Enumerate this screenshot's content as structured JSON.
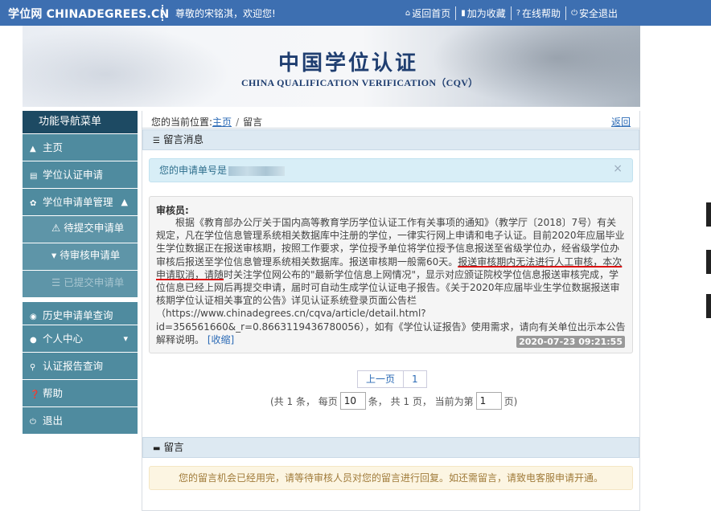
{
  "header": {
    "brand": "学位网 CHINADEGREES.CN",
    "welcome": "尊敬的宋铭淇，欢迎您!",
    "links": [
      {
        "icon": "home-icon",
        "glyph": "⌂",
        "label": "返回首页"
      },
      {
        "icon": "bookmark-icon",
        "glyph": "▮",
        "label": "加为收藏"
      },
      {
        "icon": "help-icon",
        "glyph": "?",
        "label": "在线帮助"
      },
      {
        "icon": "power-icon",
        "glyph": "⏻",
        "label": "安全退出"
      }
    ]
  },
  "banner": {
    "title_cn": "中国学位认证",
    "title_en": "CHINA QUALIFICATION VERIFICATION（CQV）"
  },
  "sidebar": {
    "title": "功能导航菜单",
    "items": [
      {
        "icon": "▲",
        "label": "主页"
      },
      {
        "icon": "▤",
        "label": "学位认证申请"
      },
      {
        "icon": "✿",
        "label": "学位申请单管理",
        "chevron": "▲"
      },
      {
        "icon": "◉",
        "label": "历史申请单查询"
      },
      {
        "icon": "●",
        "label": "个人中心",
        "chevron": "▾"
      },
      {
        "icon": "⚲",
        "label": "认证报告查询"
      },
      {
        "icon": "❓",
        "label": "帮助"
      },
      {
        "icon": "⏻",
        "label": "退出"
      }
    ],
    "subitems": [
      {
        "icon": "⚠",
        "label": "待提交申请单"
      },
      {
        "icon": "▾",
        "label": "待审核申请单"
      },
      {
        "icon": "☰",
        "label": "已提交申请单"
      }
    ]
  },
  "breadcrumb": {
    "prefix": "您的当前位置:",
    "home": "主页",
    "sep": "/",
    "current": "留言",
    "back": "返回"
  },
  "messages_panel": {
    "title": "留言消息",
    "application_no_label": "您的申请单号是",
    "close": "×",
    "reviewer_label": "审核员:",
    "body_part1": "根据《教育部办公厅关于国内高等教育学历学位认证工作有关事项的通知》（教学厅〔2018〕7号）有关规定，凡在学位信息管理系统相关数据库中注册的学位，一律实行网上申请和电子认证。目前2020年应届毕业生学位数据正在报送审核期，按照工作要求，学位授予单位将学位授予信息报送至省级学位办，经省级学位办审核后报送至学位信息管理系统相关数据库。报送审核期一般需60天。",
    "body_underlined": "报送审核期内无法进行人工审核，本次申请取消，请随",
    "body_part2": "时关注学位网公布的\"最新学位信息上网情况\"，显示对应颁证院校学位信息报送审核完成，学位信息已经上网后再提交申请，届时可自动生成学位认证电子报告。《关于2020年应届毕业生学位数据报送审核期学位认证相关事宜的公告》详见认证系统登录页面公告栏（https://www.chinadegrees.cn/cqva/article/detail.html?id=356561660&_r=0.8663119436780056），如有《学位认证报告》使用需求，请向有关单位出示本公告解释说明。",
    "fold_label": "[收缩]",
    "timestamp": "2020-07-23 09:21:55"
  },
  "pagination": {
    "prev": "上一页",
    "page": "1",
    "info_a": "(共 1 条，  每页",
    "page_size": "10",
    "info_b": "条，  共 1 页，  当前为第",
    "current_page": "1",
    "info_c": "页)"
  },
  "reply_panel": {
    "title": "留言",
    "notice": "您的留言机会已经用完，请等待审核人员对您的留言进行回复。如还需留言，请致电客服申请开通。"
  }
}
